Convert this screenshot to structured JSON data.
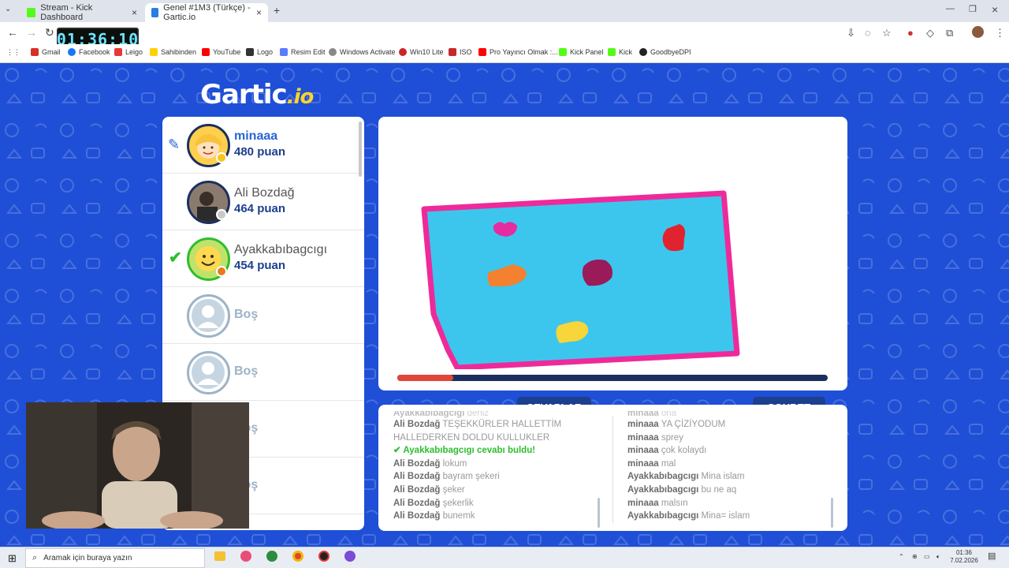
{
  "browser": {
    "tabs": [
      {
        "title": "Stream - Kick Dashboard",
        "active": false,
        "color": "#53fc18"
      },
      {
        "title": "Genel #1M3 (Türkçe) - Gartic.io",
        "active": true,
        "color": "#2a7de1"
      }
    ],
    "clock": "01:36:10",
    "bookmarks": [
      {
        "label": "Gmail",
        "color": "#d93025"
      },
      {
        "label": "Facebook",
        "color": "#1877f2"
      },
      {
        "label": "Leigo",
        "color": "#e53935"
      },
      {
        "label": "Sahibinden",
        "color": "#ffd000"
      },
      {
        "label": "YouTube",
        "color": "#ff0000"
      },
      {
        "label": "Logo",
        "color": "#333333"
      },
      {
        "label": "Resim Edit",
        "color": "#5a7cff"
      },
      {
        "label": "Windows Activate",
        "color": "#888888"
      },
      {
        "label": "Win10 Lite",
        "color": "#c62828"
      },
      {
        "label": "ISO",
        "color": "#c62828"
      },
      {
        "label": "Pro Yayıncı Olmak :...",
        "color": "#ff0000"
      },
      {
        "label": "Kick Panel",
        "color": "#53fc18"
      },
      {
        "label": "Kick",
        "color": "#53fc18"
      },
      {
        "label": "GoodbyeDPI",
        "color": "#222222"
      }
    ]
  },
  "game": {
    "logo": {
      "main": "Gartic",
      "suffix": ".io"
    },
    "players": [
      {
        "name": "minaaa",
        "score": "480 puan",
        "status": "drawing",
        "badge_color": "#f5c518"
      },
      {
        "name": "Ali Bozdağ",
        "score": "464 puan",
        "status": "none",
        "badge_color": "#c9c9c9"
      },
      {
        "name": "Ayakkabıbagcıgı",
        "score": "454 puan",
        "status": "guessed",
        "badge_color": "#e87a1d"
      },
      {
        "name": "Boş",
        "score": "",
        "status": "empty"
      },
      {
        "name": "Boş",
        "score": "",
        "status": "empty"
      },
      {
        "name": "Boş",
        "score": "",
        "status": "empty"
      },
      {
        "name": "Boş",
        "score": "",
        "status": "empty"
      }
    ],
    "timer_progress": 0.13,
    "answers_title": "CEVAPLAR",
    "chat_title": "SOHBET",
    "answers": [
      {
        "user": "Ayakkabıbagcıgı",
        "text": "deniz",
        "faded": true
      },
      {
        "user": "Ali Bozdağ",
        "text": "TEŞEKKÜRLER HALLETTİM HALLEDERKEN DOLDU KULLUKLER"
      },
      {
        "user": "Ayakkabıbagcıgı",
        "text": "cevabı buldu!",
        "found": true
      },
      {
        "user": "Ali Bozdağ",
        "text": "lokum"
      },
      {
        "user": "Ali Bozdağ",
        "text": "bayram şekeri"
      },
      {
        "user": "Ali Bozdağ",
        "text": "şeker"
      },
      {
        "user": "Ali Bozdağ",
        "text": "şekerlik"
      },
      {
        "user": "Ali Bozdağ",
        "text": "bunemk"
      }
    ],
    "chat": [
      {
        "user": "minaaa",
        "text": "ona",
        "faded": true
      },
      {
        "user": "minaaa",
        "text": "YA ÇİZİYODUM"
      },
      {
        "user": "minaaa",
        "text": "sprey"
      },
      {
        "user": "minaaa",
        "text": "çok kolaydı"
      },
      {
        "user": "minaaa",
        "text": "mal"
      },
      {
        "user": "Ayakkabıbagcıgı",
        "text": "Mina islam"
      },
      {
        "user": "Ayakkabıbagcıgı",
        "text": "bu ne aq"
      },
      {
        "user": "minaaa",
        "text": "malsın"
      },
      {
        "user": "Ayakkabıbagcıgı",
        "text": "Mina= islam"
      }
    ]
  },
  "taskbar": {
    "search_placeholder": "Aramak için buraya yazın",
    "time": "01:36",
    "date": "7.02.2026"
  }
}
